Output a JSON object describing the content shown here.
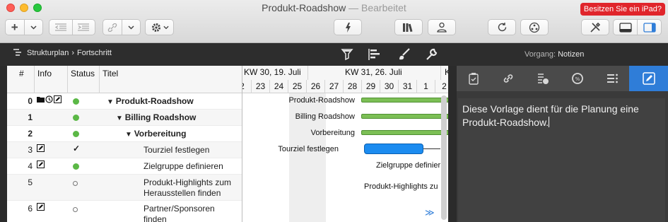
{
  "window": {
    "title": "Produkt-Roadshow",
    "subtitle": "— Bearbeitet",
    "ipad_button": "Besitzen Sie ein iPad?"
  },
  "toolbar": {
    "add_label": "+",
    "icons": [
      "plus-icon",
      "chevron-down-icon",
      "outdent-icon",
      "indent-icon",
      "link-icon",
      "gear-icon",
      "critical-path-icon",
      "library-icon",
      "person-icon",
      "refresh-icon",
      "network-icon",
      "tools-icon",
      "bottom-panel-icon",
      "side-panel-icon"
    ]
  },
  "breadcrumb": {
    "items": [
      "Strukturplan",
      "Fortschritt"
    ]
  },
  "inspector_header": {
    "label": "Vorgang:",
    "value": "Notizen"
  },
  "table": {
    "columns": [
      "#",
      "Info",
      "Status",
      "Titel"
    ],
    "rows": [
      {
        "num": "0",
        "info": [
          "folder",
          "clock",
          "note"
        ],
        "status": "green",
        "title": "Produkt-Roadshow",
        "level": 0,
        "bold": true,
        "group": true
      },
      {
        "num": "1",
        "info": [],
        "status": "green",
        "title": "Billing Roadshow",
        "level": 1,
        "bold": true,
        "group": true
      },
      {
        "num": "2",
        "info": [],
        "status": "green",
        "title": "Vorbereitung",
        "level": 2,
        "bold": true,
        "group": true
      },
      {
        "num": "3",
        "info": [
          "note"
        ],
        "status": "check",
        "title": "Tourziel festlegen",
        "level": 3,
        "bold": false,
        "group": false
      },
      {
        "num": "4",
        "info": [
          "note"
        ],
        "status": "green",
        "title": "Zielgruppe definieren",
        "level": 3,
        "bold": false,
        "group": false
      },
      {
        "num": "5",
        "info": [],
        "status": "open",
        "title": "Produkt-Highlights zum Herausstellen finden",
        "level": 3,
        "bold": false,
        "group": false
      },
      {
        "num": "6",
        "info": [
          "note"
        ],
        "status": "open",
        "title": "Partner/Sponsoren finden",
        "level": 3,
        "bold": false,
        "group": false
      }
    ]
  },
  "gantt": {
    "weeks": [
      "KW 30, 19. Juli",
      "KW 31, 26. Juli",
      "K"
    ],
    "days": [
      "2",
      "23",
      "24",
      "25",
      "26",
      "27",
      "28",
      "29",
      "30",
      "31",
      "1",
      "2"
    ],
    "labels": [
      "Produkt-Roadshow",
      "Billing Roadshow",
      "Vorbereitung",
      "Tourziel festlegen",
      "Zielgruppe definier",
      "Produkt-Highlights zu"
    ],
    "more_symbol": "≫"
  },
  "inspector": {
    "tabs": [
      "clipboard-icon",
      "link-icon",
      "cost-icon",
      "progress-icon",
      "list-icon",
      "notes-edit-icon"
    ],
    "active_tab": 5,
    "notes_text": "Diese Vorlage dient für die Planung eine Produkt-Roadshow."
  },
  "colors": {
    "accent": "#2f7dd8",
    "status_green": "#5bb846",
    "task_blue": "#1c8cf0",
    "summary_green": "#7cbf55",
    "ipad_red": "#e0252b"
  }
}
